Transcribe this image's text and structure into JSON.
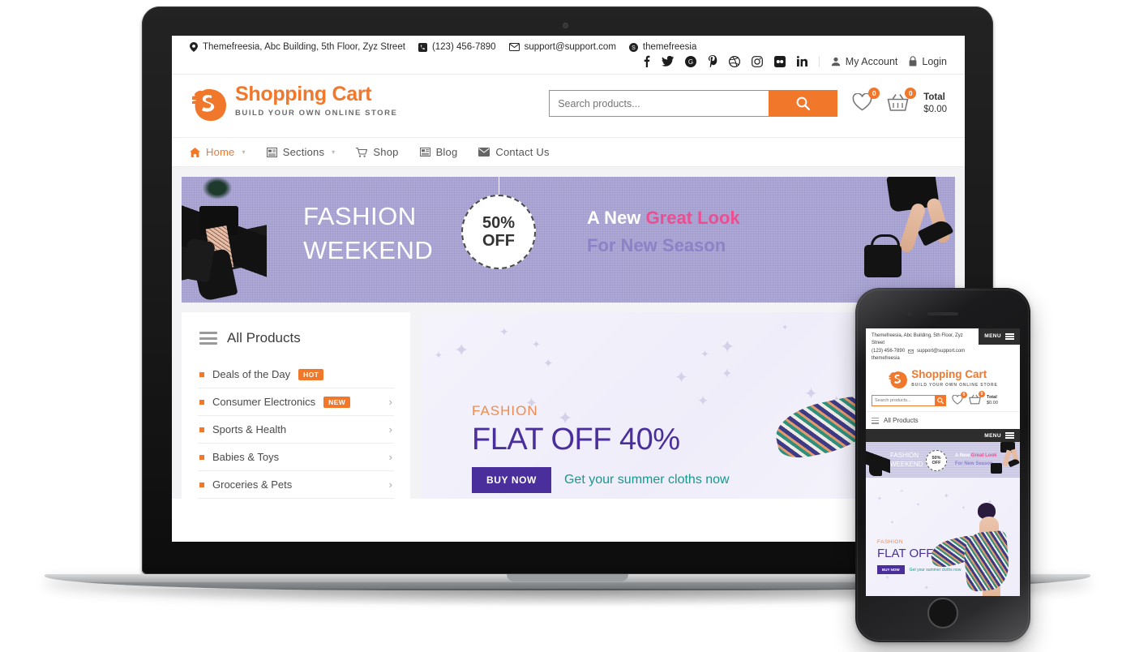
{
  "topbar": {
    "address": "Themefreesia, Abc Building, 5th Floor, Zyz Street",
    "phone": "(123) 456-7890",
    "email": "support@support.com",
    "skype": "themefreesia",
    "my_account": "My Account",
    "login": "Login",
    "social": [
      "facebook-icon",
      "twitter-icon",
      "google-plus-icon",
      "pinterest-icon",
      "dribbble-icon",
      "instagram-icon",
      "flickr-icon",
      "linkedin-icon"
    ]
  },
  "header": {
    "brand": "Shopping Cart",
    "tagline": "BUILD YOUR OWN ONLINE STORE",
    "search_placeholder": "Search products...",
    "wishlist_count": "0",
    "cart_count": "0",
    "total_label": "Total",
    "total_amount": "$0.00"
  },
  "nav": [
    {
      "label": "Home",
      "icon": "home-icon",
      "caret": "▾",
      "active": true
    },
    {
      "label": "Sections",
      "icon": "sections-icon",
      "caret": "▾",
      "active": false
    },
    {
      "label": "Shop",
      "icon": "cart-icon",
      "caret": "",
      "active": false
    },
    {
      "label": "Blog",
      "icon": "blog-icon",
      "caret": "",
      "active": false
    },
    {
      "label": "Contact Us",
      "icon": "envelope-icon",
      "caret": "",
      "active": false
    }
  ],
  "hero": {
    "line1": "FASHION",
    "line2": "WEEKEND",
    "badge_percent": "50%",
    "badge_off": "OFF",
    "right_white": "A New ",
    "right_pink": "Great Look",
    "right_purple": "For New Season"
  },
  "sidebar": {
    "title": "All Products",
    "items": [
      {
        "label": "Deals of the Day",
        "badge": "HOT",
        "chevron": ""
      },
      {
        "label": "Consumer Electronics",
        "badge": "NEW",
        "chevron": "›"
      },
      {
        "label": "Sports & Health",
        "badge": "",
        "chevron": "›"
      },
      {
        "label": "Babies & Toys",
        "badge": "",
        "chevron": "›"
      },
      {
        "label": "Groceries & Pets",
        "badge": "",
        "chevron": "›"
      }
    ]
  },
  "promo": {
    "kicker": "FASHION",
    "headline": "FLAT OFF 40%",
    "button": "BUY NOW",
    "subtext": "Get your summer cloths now"
  },
  "mobile": {
    "address": "Themefreesia, Abc Building, 5th Floor, Zyz Street",
    "phone": "(123) 456-7890",
    "email": "support@support.com",
    "skype": "themefreesia",
    "menu_label": "MENU",
    "brand": "Shopping Cart",
    "tagline": "BUILD YOUR OWN ONLINE STORE",
    "search_placeholder": "Search products...",
    "wishlist_count": "0",
    "cart_count": "0",
    "total_label": "Total",
    "total_amount": "$0.00",
    "all_products": "All Products",
    "menu_bar_label": "MENU",
    "hero_line1": "FASHION",
    "hero_line2": "WEEKEND",
    "hero_badge_percent": "50%",
    "hero_badge_off": "OFF",
    "hero_white": "A New ",
    "hero_pink": "Great Look",
    "hero_purple": "For New Season",
    "promo_kicker": "FASHION",
    "promo_headline": "FLAT OFF 40%",
    "promo_button": "BUY NOW",
    "promo_sub": "Get your summer cloths now"
  },
  "colors": {
    "accent": "#f1772b",
    "purple": "#4a2f9c",
    "pink": "#ec4f91",
    "teal": "#18988f",
    "hero_bg": "#cdcae6"
  }
}
